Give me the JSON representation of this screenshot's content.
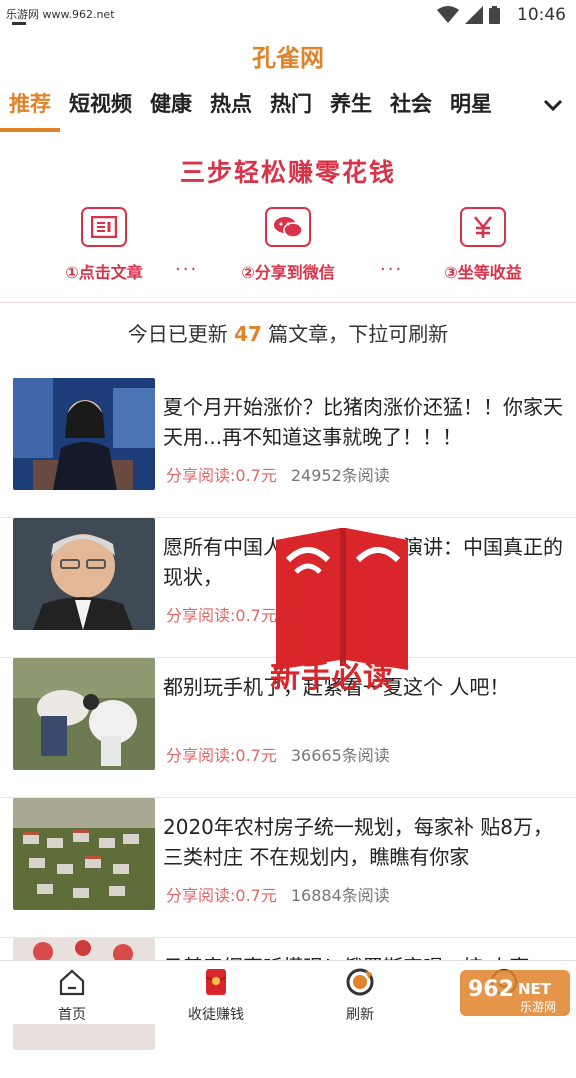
{
  "status_bar": {
    "site": "乐游网 www.962.net",
    "time": "10:46"
  },
  "app": {
    "title": "孔雀网"
  },
  "tabs": [
    {
      "label": "推荐",
      "active": true
    },
    {
      "label": "短视频"
    },
    {
      "label": "健康"
    },
    {
      "label": "热点"
    },
    {
      "label": "热门"
    },
    {
      "label": "养生"
    },
    {
      "label": "社会"
    },
    {
      "label": "明星"
    }
  ],
  "banner": {
    "title": "三步轻松赚零花钱",
    "steps": [
      {
        "label": "①点击文章",
        "icon": "article-icon"
      },
      {
        "label": "②分享到微信",
        "icon": "wechat-icon"
      },
      {
        "label": "③坐等收益",
        "icon": "yuan-icon"
      }
    ],
    "dots": "···"
  },
  "update": {
    "prefix": "今日已更新 ",
    "count": "47",
    "suffix": " 篇文章，下拉可刷新"
  },
  "articles": [
    {
      "title": "夏个月开始涨价？比猪肉涨价还猛！！你家天天用...再不知道这事就晚了！！！",
      "reward": "分享阅读:0.7元",
      "reads": "24952条阅读"
    },
    {
      "title": "愿所有中国人都有幸听到这演讲：中国真正的现状，",
      "reward": "分享阅读:0.7元",
      "reads": ""
    },
    {
      "title": "都别玩手机了，赶紧看一夏这个 人吧！",
      "reward": "分享阅读:0.7元",
      "reads": "36665条阅读"
    },
    {
      "title": "2020年农村房子统一规划，每家补 贴8万，三类村庄 不在规划内，瞧瞧有你家",
      "reward": "分享阅读:0.7元",
      "reads": "16884条阅读"
    },
    {
      "title": "日基音纲声听懂眼！俄罗斯突喝，惊 人事",
      "reward": "",
      "reads": ""
    }
  ],
  "guide": {
    "label": "新手必读"
  },
  "bottom_nav": [
    {
      "label": "首页",
      "icon": "home-icon"
    },
    {
      "label": "收徒赚钱",
      "icon": "red-envelope-icon"
    },
    {
      "label": "刷新",
      "icon": "refresh-icon"
    },
    {
      "label": "",
      "icon": "profile-icon"
    }
  ],
  "watermark": {
    "text": "962 NET 乐游网"
  },
  "colors": {
    "accent": "#e0832a",
    "red": "#d9334a",
    "reward": "#e06767"
  }
}
